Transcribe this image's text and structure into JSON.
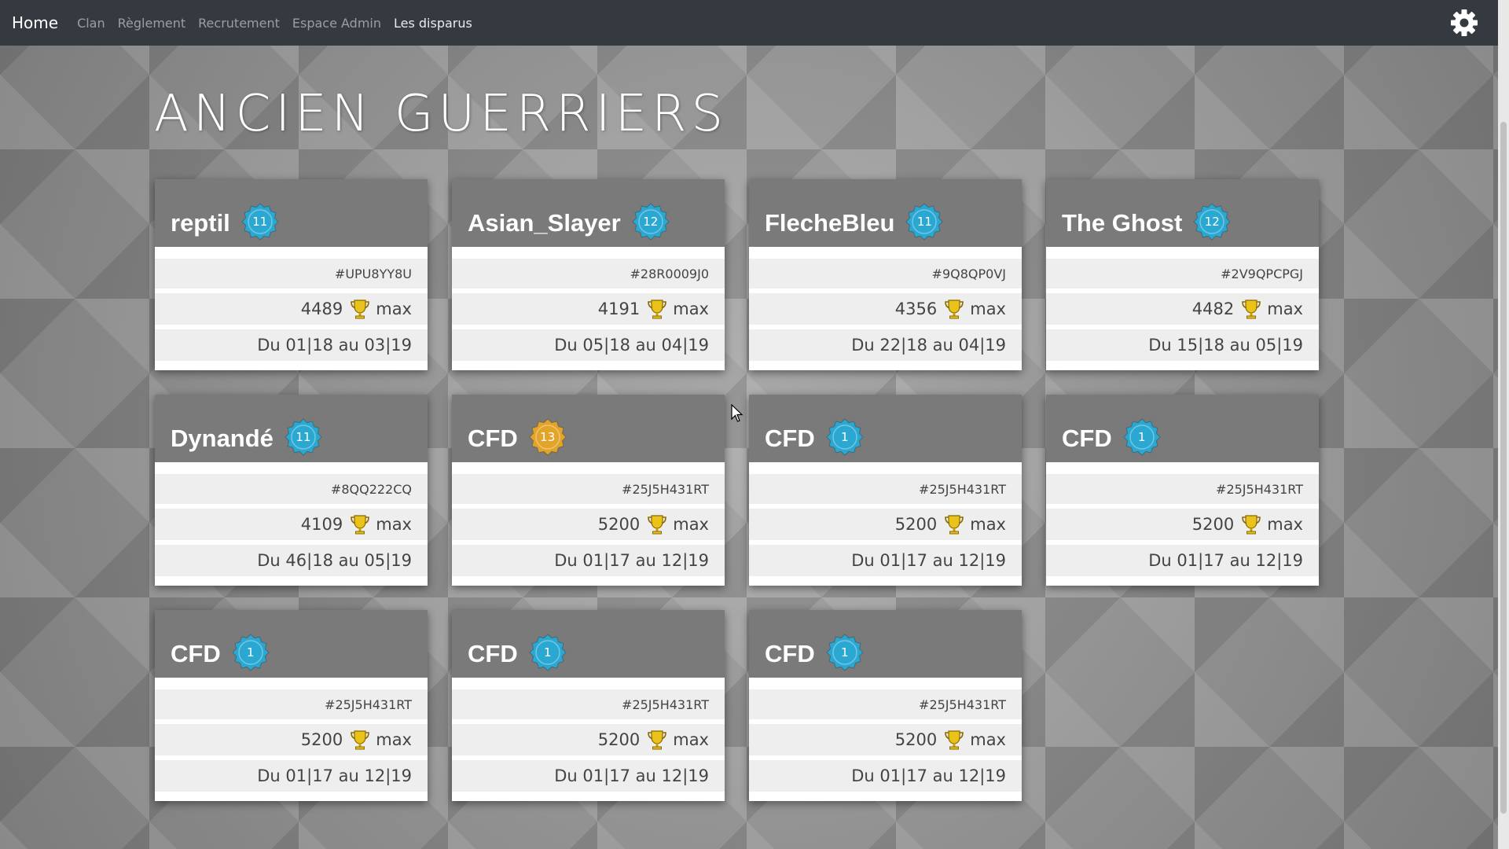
{
  "nav": {
    "brand": "Home",
    "links": [
      "Clan",
      "Règlement",
      "Recrutement",
      "Espace Admin",
      "Les disparus"
    ],
    "active_index": 4,
    "settings_icon": "gear-icon"
  },
  "page": {
    "title": "ANCIEN GUERRIERS"
  },
  "colors": {
    "badge_blue": "#2aa8d2",
    "badge_gold": "#e2a52a",
    "nav_bg": "#343a40"
  },
  "trophy_icon": "trophy-icon",
  "max_label": "max",
  "members": [
    {
      "name": "reptil",
      "level": "11",
      "badge": "blue",
      "tag": "#UPU8YY8U",
      "trophies": "4489",
      "dates": "Du 01|18 au 03|19"
    },
    {
      "name": "Asian_Slayer",
      "level": "12",
      "badge": "blue",
      "tag": "#28R0009J0",
      "trophies": "4191",
      "dates": "Du 05|18 au 04|19"
    },
    {
      "name": "FlecheBleu",
      "level": "11",
      "badge": "blue",
      "tag": "#9Q8QP0VJ",
      "trophies": "4356",
      "dates": "Du 22|18 au 04|19"
    },
    {
      "name": "The Ghost",
      "level": "12",
      "badge": "blue",
      "tag": "#2V9QPCPGJ",
      "trophies": "4482",
      "dates": "Du 15|18 au 05|19"
    },
    {
      "name": "Dynandé",
      "level": "11",
      "badge": "blue",
      "tag": "#8QQ222CQ",
      "trophies": "4109",
      "dates": "Du 46|18 au 05|19"
    },
    {
      "name": "CFD",
      "level": "13",
      "badge": "gold",
      "tag": "#25J5H431RT",
      "trophies": "5200",
      "dates": "Du 01|17 au 12|19"
    },
    {
      "name": "CFD",
      "level": "1",
      "badge": "blue",
      "tag": "#25J5H431RT",
      "trophies": "5200",
      "dates": "Du 01|17 au 12|19"
    },
    {
      "name": "CFD",
      "level": "1",
      "badge": "blue",
      "tag": "#25J5H431RT",
      "trophies": "5200",
      "dates": "Du 01|17 au 12|19"
    },
    {
      "name": "CFD",
      "level": "1",
      "badge": "blue",
      "tag": "#25J5H431RT",
      "trophies": "5200",
      "dates": "Du 01|17 au 12|19"
    },
    {
      "name": "CFD",
      "level": "1",
      "badge": "blue",
      "tag": "#25J5H431RT",
      "trophies": "5200",
      "dates": "Du 01|17 au 12|19"
    },
    {
      "name": "CFD",
      "level": "1",
      "badge": "blue",
      "tag": "#25J5H431RT",
      "trophies": "5200",
      "dates": "Du 01|17 au 12|19"
    }
  ]
}
